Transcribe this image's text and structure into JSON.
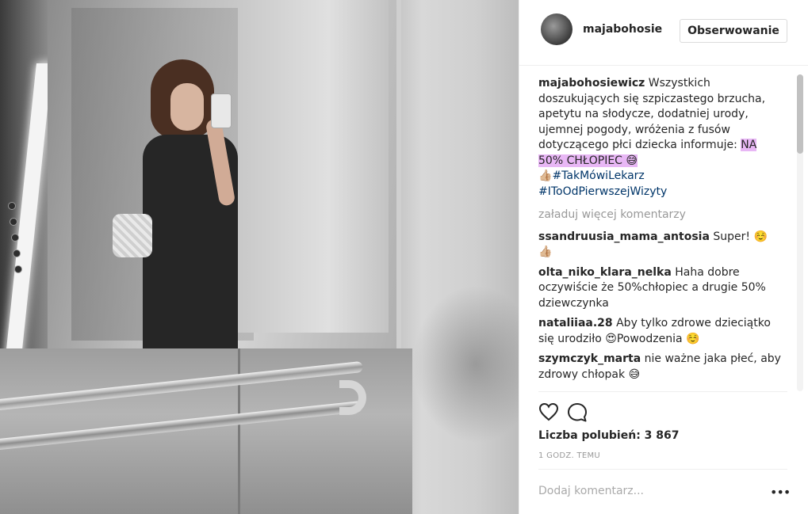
{
  "post": {
    "username": "majabohosie",
    "follow_label": "Obserwowanie",
    "caption": {
      "author": "majabohosiewicz",
      "text_before": "Wszystkich doszukujących się szpiczastego brzucha, apetytu na słodycze, dodatniej urody, ujemnej pogody, wróżenia z fusów dotyczącego płci dziecka informuje: ",
      "highlight": "NA 50% CHŁOPIEC 😅",
      "emoji": "👍🏼",
      "tag1": "#TakMówiLekarz",
      "tag2": "#IToOdPierwszejWizyty"
    },
    "load_more": "załaduj więcej komentarzy",
    "comments": [
      {
        "author": "ssandruusia_mama_antosia",
        "text": "Super! ☺️ 👍🏼"
      },
      {
        "author": "olta_niko_klara_nelka",
        "text": "Haha dobre oczywiście że 50%chłopiec a drugie 50% dziewczynka"
      },
      {
        "author": "nataliiaa.28",
        "text": "Aby tylko zdrowe dzieciątko się urodziło 😍Powodzenia ☺️"
      },
      {
        "author": "szymczyk_marta",
        "text": "nie ważne jaka płeć, aby zdrowy chłopak 😅"
      }
    ],
    "likes": "Liczba polubień: 3 867",
    "time": "1 GODZ. TEMU",
    "add_comment_placeholder": "Dodaj komentarz...",
    "more_options": "•••"
  },
  "icons": {
    "like": "heart-icon",
    "comment": "comment-icon"
  }
}
